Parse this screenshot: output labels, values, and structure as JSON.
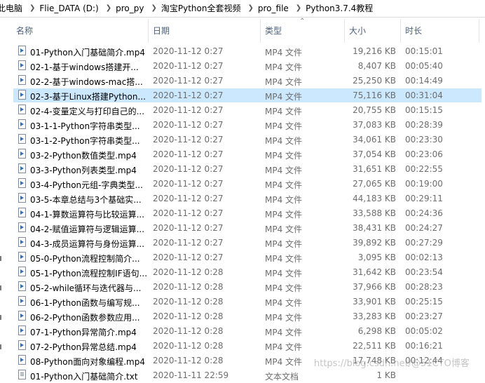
{
  "breadcrumb": [
    "此电脑",
    "Flie_DATA (D:)",
    "pro_py",
    "淘宝Python全套视频",
    "pro_file",
    "Python3.7.4教程"
  ],
  "columns": {
    "name": "名称",
    "date": "日期",
    "type": "类型",
    "size": "大小",
    "duration": "时长"
  },
  "files": [
    {
      "name": "01-Python入门基础简介.mp4",
      "date": "2020-11-12 0:27",
      "type": "MP4 文件",
      "size": "19,216 KB",
      "duration": "00:15:01"
    },
    {
      "name": "02-1-基于windows搭建开...",
      "date": "2020-11-12 0:27",
      "type": "MP4 文件",
      "size": "8,407 KB",
      "duration": "00:05:40"
    },
    {
      "name": "02-2-基于windows-mac搭...",
      "date": "2020-11-12 0:27",
      "type": "MP4 文件",
      "size": "25,250 KB",
      "duration": "00:14:49"
    },
    {
      "name": "02-3-基于Linux搭建Python...",
      "date": "2020-11-12 0:27",
      "type": "MP4 文件",
      "size": "75,116 KB",
      "duration": "00:31:04",
      "selected": true
    },
    {
      "name": "02-4-变量定义与打印自己的...",
      "date": "2020-11-12 0:27",
      "type": "MP4 文件",
      "size": "20,755 KB",
      "duration": "00:15:15"
    },
    {
      "name": "03-1-1-Python字符串类型...",
      "date": "2020-11-12 0:27",
      "type": "MP4 文件",
      "size": "37,083 KB",
      "duration": "00:28:39"
    },
    {
      "name": "03-1-2-Python字符串类型...",
      "date": "2020-11-12 0:27",
      "type": "MP4 文件",
      "size": "34,061 KB",
      "duration": "00:23:30"
    },
    {
      "name": "03-2-Python数值类型.mp4",
      "date": "2020-11-12 0:27",
      "type": "MP4 文件",
      "size": "37,054 KB",
      "duration": "00:23:06"
    },
    {
      "name": "03-3-Python列表类型.mp4",
      "date": "2020-11-12 0:27",
      "type": "MP4 文件",
      "size": "31,651 KB",
      "duration": "00:22:55"
    },
    {
      "name": "03-4-Python元组-字典类型...",
      "date": "2020-11-12 0:27",
      "type": "MP4 文件",
      "size": "27,065 KB",
      "duration": "00:19:00"
    },
    {
      "name": "03-5-本章总结与3个基础实...",
      "date": "2020-11-12 0:27",
      "type": "MP4 文件",
      "size": "44,183 KB",
      "duration": "00:29:11"
    },
    {
      "name": "04-1-算数运算符与比较运算...",
      "date": "2020-11-12 0:27",
      "type": "MP4 文件",
      "size": "33,588 KB",
      "duration": "00:24:36"
    },
    {
      "name": "04-2-赋值运算符与逻辑运算...",
      "date": "2020-11-12 0:27",
      "type": "MP4 文件",
      "size": "38,431 KB",
      "duration": "00:24:27"
    },
    {
      "name": "04-3-成员运算符与身份运算...",
      "date": "2020-11-12 0:27",
      "type": "MP4 文件",
      "size": "39,892 KB",
      "duration": "00:27:29"
    },
    {
      "name": "05-0-Python流程控制简介...",
      "date": "2020-11-12 0:27",
      "type": "MP4 文件",
      "size": "3,095 KB",
      "duration": "00:02:13"
    },
    {
      "name": "05-1-Python流程控制IF语句...",
      "date": "2020-11-12 0:28",
      "type": "MP4 文件",
      "size": "31,642 KB",
      "duration": "00:23:54"
    },
    {
      "name": "05-2-while循环与迭代器与...",
      "date": "2020-11-12 0:28",
      "type": "MP4 文件",
      "size": "37,966 KB",
      "duration": "00:28:23"
    },
    {
      "name": "06-1-Python函数与编写规...",
      "date": "2020-11-12 0:28",
      "type": "MP4 文件",
      "size": "33,901 KB",
      "duration": "00:25:15"
    },
    {
      "name": "06-2-Python函数参数应用...",
      "date": "2020-11-12 0:28",
      "type": "MP4 文件",
      "size": "33,283 KB",
      "duration": "00:23:27"
    },
    {
      "name": "07-1-Python异常简介.mp4",
      "date": "2020-11-12 0:28",
      "type": "MP4 文件",
      "size": "6,298 KB",
      "duration": "00:05:02"
    },
    {
      "name": "07-2-Python异常总结.mp4",
      "date": "2020-11-12 0:28",
      "type": "MP4 文件",
      "size": "22,511 KB",
      "duration": "00:16:21"
    },
    {
      "name": "08-Python面向对象编程.mp4",
      "date": "2020-11-12 0:28",
      "type": "MP4 文件",
      "size": "17,748 KB",
      "duration": "00:12:44"
    },
    {
      "name": "01-Python入门基础简介.txt",
      "date": "2020-11-11 22:59",
      "type": "文本文档",
      "size": "1 KB",
      "duration": "",
      "icon": "txt"
    }
  ],
  "watermark": "https://blog.csdn.net/@51CTO博客",
  "colors": {
    "selected_row": "#cce8ff",
    "header_text": "#4c607a"
  }
}
